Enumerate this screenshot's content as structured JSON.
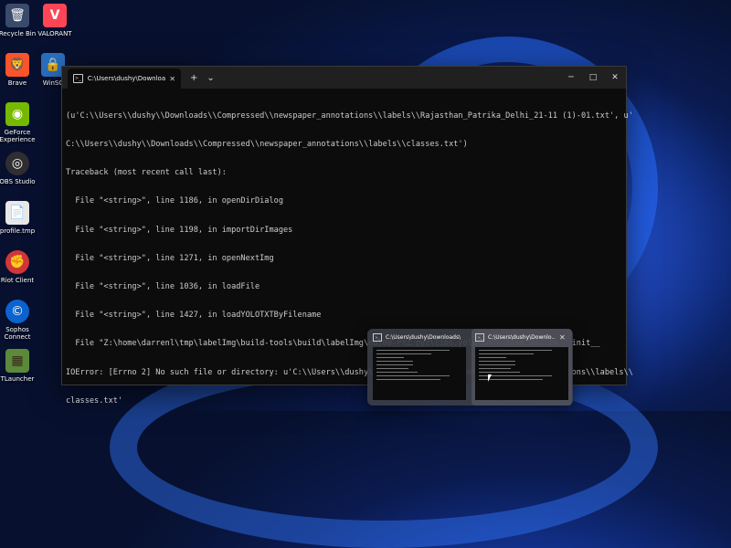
{
  "desktop": {
    "icons": [
      {
        "label": "Recycle Bin",
        "icon": "recycle-bin-icon",
        "glyph": "🗑",
        "bg": "#3a4a6a"
      },
      {
        "label": "VALORANT",
        "icon": "valorant-icon",
        "glyph": "V",
        "bg": "#fd4556"
      },
      {
        "label": "Brave",
        "icon": "brave-icon",
        "glyph": "🦁",
        "bg": "#fb542b"
      },
      {
        "label": "WinSC",
        "icon": "winscp-icon",
        "glyph": "🔒",
        "bg": "#2a6fbf"
      },
      {
        "label": "GeForce Experience",
        "icon": "geforce-icon",
        "glyph": "◉",
        "bg": "#76b900"
      },
      {
        "label": "OBS Studio",
        "icon": "obs-icon",
        "glyph": "◎",
        "bg": "#302e31"
      },
      {
        "label": "profile.tmp",
        "icon": "file-icon",
        "glyph": "📄",
        "bg": "#e8e8e8"
      },
      {
        "label": "Riot Client",
        "icon": "riot-client-icon",
        "glyph": "✊",
        "bg": "#d13639"
      },
      {
        "label": "Sophos Connect",
        "icon": "sophos-icon",
        "glyph": "©",
        "bg": "#0b63ce"
      },
      {
        "label": "TLauncher",
        "icon": "tlauncher-icon",
        "glyph": "▦",
        "bg": "#5a8a3a"
      }
    ]
  },
  "terminal": {
    "tab_title": "C:\\Users\\dushy\\Downloads\\C",
    "new_tab": "+",
    "dropdown": "⌄",
    "minimize": "─",
    "maximize": "□",
    "close": "✕",
    "tab_close": "✕",
    "lines": [
      "(u'C:\\\\Users\\\\dushy\\\\Downloads\\\\Compressed\\\\newspaper_annotations\\\\labels\\\\Rajasthan_Patrika_Delhi_21-11 (1)-01.txt', u'",
      "C:\\\\Users\\\\dushy\\\\Downloads\\\\Compressed\\\\newspaper_annotations\\\\labels\\\\classes.txt')",
      "Traceback (most recent call last):",
      "  File \"<string>\", line 1186, in openDirDialog",
      "  File \"<string>\", line 1198, in importDirImages",
      "  File \"<string>\", line 1271, in openNextImg",
      "  File \"<string>\", line 1036, in loadFile",
      "  File \"<string>\", line 1427, in loadYOLOTXTByFilename",
      "  File \"Z:\\home\\darrenl\\tmp\\labelImg\\build-tools\\build\\labelImg\\out00-PYZ.pyz\\libs.yolo_io\", line 94, in __init__",
      "IOError: [Errno 2] No such file or directory: u'C:\\\\Users\\\\dushy\\\\Downloads\\\\Compressed\\\\newspaper_annotations\\\\labels\\\\",
      "classes.txt'"
    ]
  },
  "taskbar_preview": {
    "items": [
      {
        "title": "C:\\Users\\dushy\\Downloads\\Co..."
      },
      {
        "title": "C:\\Users\\dushy\\Downlo...",
        "close": "✕"
      }
    ]
  }
}
